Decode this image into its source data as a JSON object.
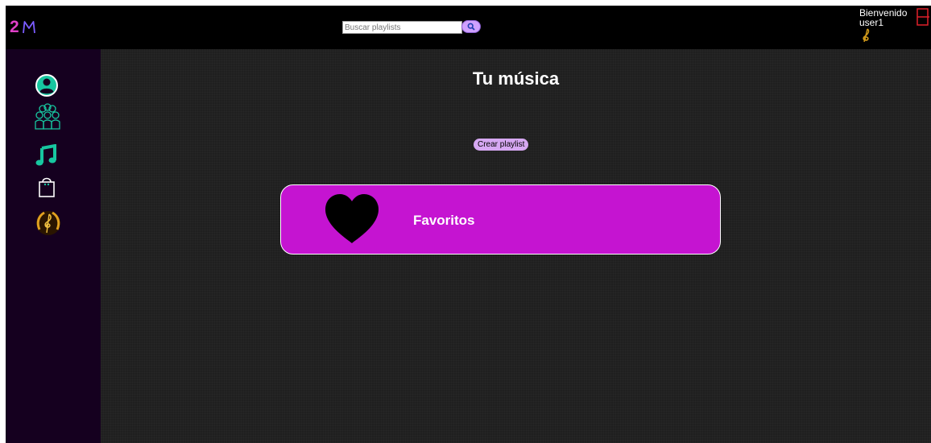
{
  "header": {
    "logo_text": "2",
    "logo_mark": "M",
    "search": {
      "placeholder": "Buscar playlists",
      "button_icon": "search-icon"
    },
    "welcome": "Bienvenido",
    "username": "user1",
    "user_badge_icon": "treble-clef-icon",
    "logout_icon": "logout-icon"
  },
  "sidebar": {
    "items": [
      {
        "icon": "user-icon"
      },
      {
        "icon": "group-icon"
      },
      {
        "icon": "music-note-icon",
        "active": true
      },
      {
        "icon": "shopping-bag-icon"
      },
      {
        "icon": "laurel-clef-icon"
      }
    ]
  },
  "main": {
    "title": "Tu música",
    "create_button": "Crear playlist",
    "playlists": [
      {
        "name": "Favoritos",
        "icon": "heart-icon"
      }
    ]
  },
  "colors": {
    "accent_pink": "#c514d1",
    "create_button": "#d6a8f2",
    "active_icon": "#17c7a0",
    "logout": "#e0202a",
    "sidebar_bg": "#15001f"
  }
}
